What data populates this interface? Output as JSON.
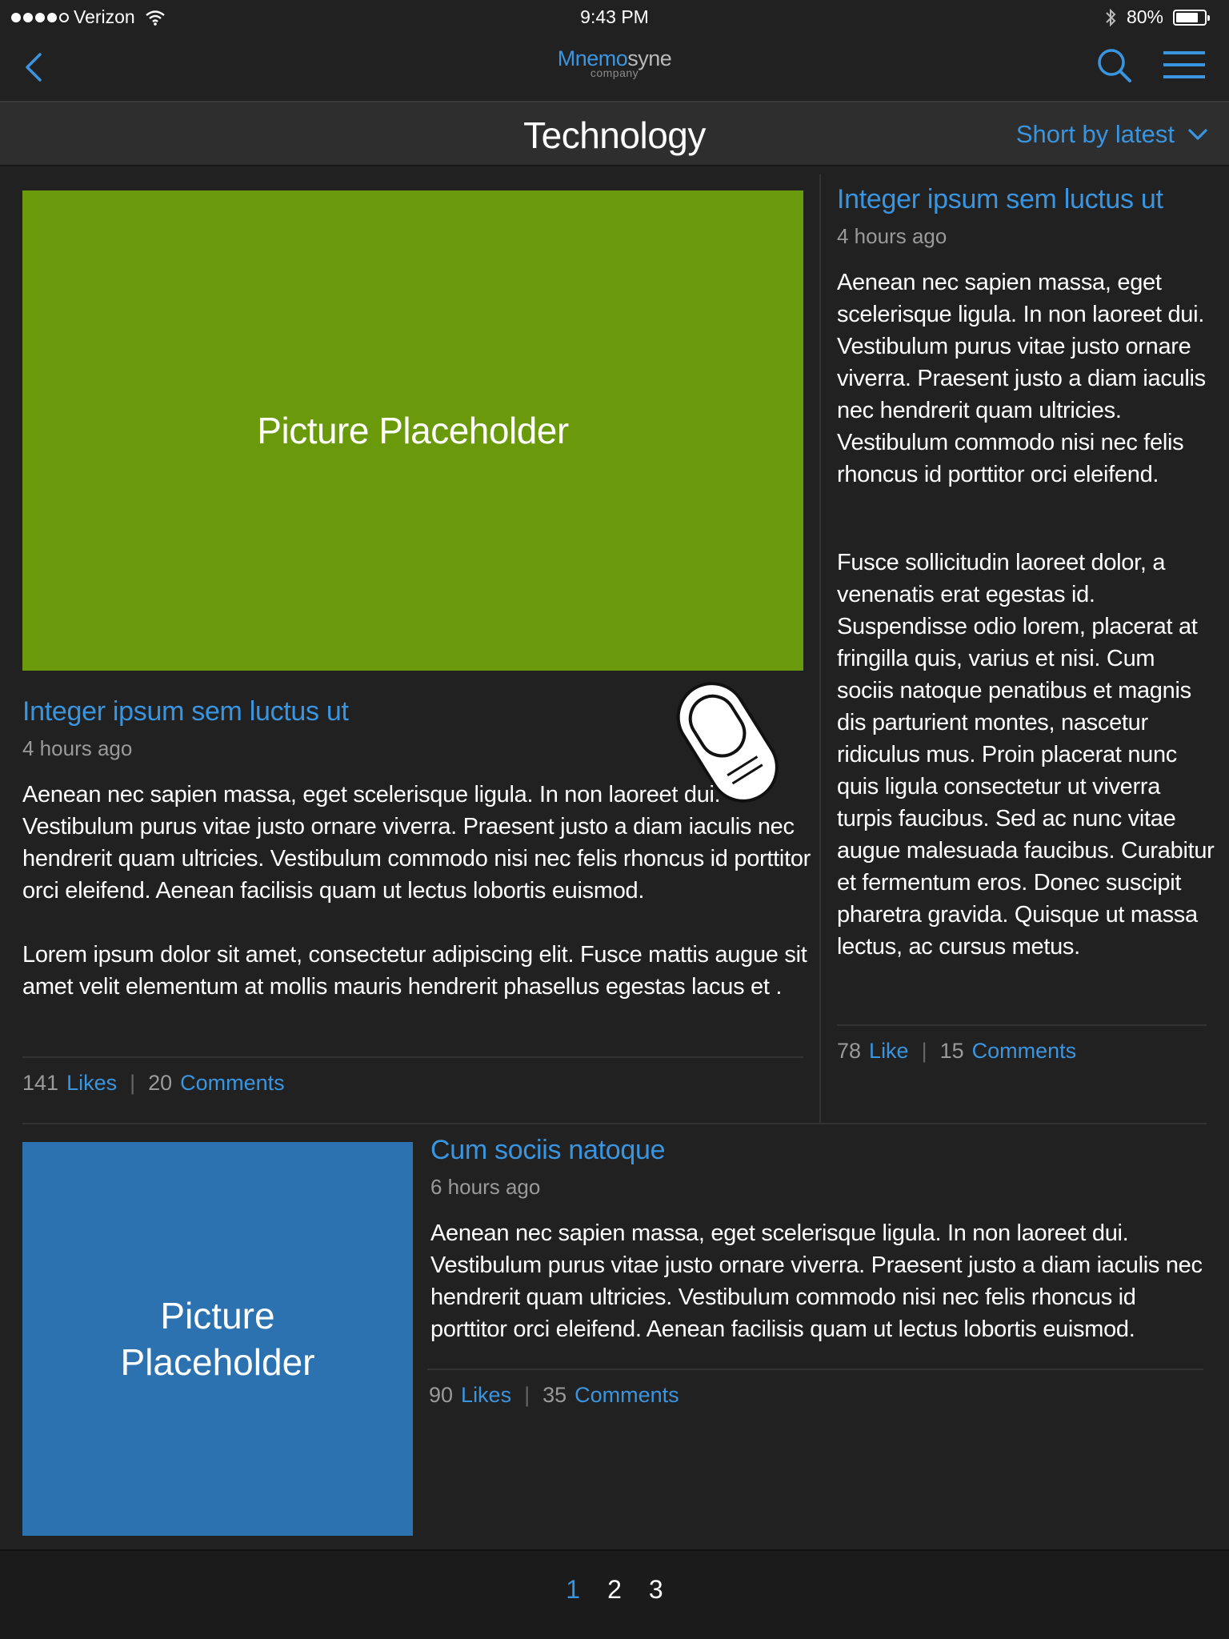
{
  "status_bar": {
    "carrier": "Verizon",
    "time": "9:43 PM",
    "battery_text": "80%",
    "battery_level": 0.8
  },
  "nav": {
    "logo_part1": "Mnemo",
    "logo_part2": "syne",
    "logo_sub": "company"
  },
  "category": {
    "title": "Technology",
    "sort_label": "Short by latest"
  },
  "articles": [
    {
      "image_label": "Picture Placeholder",
      "image_color": "#6a9a0b",
      "title": "Integer ipsum sem luctus ut",
      "time": "4 hours ago",
      "paragraph1": "Aenean nec sapien massa, eget scelerisque ligula. In non laoreet dui. Vestibulum purus vitae justo ornare viverra. Praesent justo a diam iaculis nec hendrerit quam ultricies. Vestibulum commodo nisi nec felis rhoncus id porttitor orci eleifend. Aenean facilisis quam ut lectus lobortis euismod.",
      "paragraph2": "Lorem ipsum dolor sit amet, consectetur adipiscing elit. Fusce mattis augue sit amet velit elementum at mollis mauris hendrerit phasellus egestas lacus et .",
      "likes_count": "141",
      "likes_label": "Likes",
      "comments_count": "20",
      "comments_label": "Comments"
    },
    {
      "title": "Integer ipsum sem luctus ut",
      "time": "4 hours ago",
      "paragraph1": "Aenean nec sapien massa, eget scelerisque ligula. In non laoreet dui. Vestibulum purus vitae justo ornare viverra. Praesent justo a diam iaculis nec hendrerit quam ultricies. Vestibulum commodo nisi nec felis rhoncus id porttitor orci eleifend.",
      "paragraph2": "Fusce sollicitudin laoreet dolor, a venenatis erat egestas id. Suspendisse odio lorem, placerat at fringilla quis, varius et nisi. Cum sociis natoque penatibus et magnis dis parturient montes, nascetur ridiculus mus. Proin placerat nunc quis ligula consectetur ut viverra turpis faucibus. Sed ac nunc vitae augue malesuada faucibus. Curabitur et fermentum eros. Donec suscipit pharetra gravida. Quisque ut massa lectus, ac cursus metus.",
      "likes_count": "78",
      "likes_label": "Like",
      "comments_count": "15",
      "comments_label": "Comments"
    },
    {
      "image_label_line1": "Picture",
      "image_label_line2": "Placeholder",
      "image_color": "#2d72b0",
      "title": "Cum sociis natoque",
      "time": "6 hours ago",
      "paragraph1": "Aenean nec sapien massa, eget scelerisque ligula. In non laoreet dui. Vestibulum purus vitae justo ornare viverra. Praesent justo a diam iaculis nec hendrerit quam ultricies. Vestibulum commodo nisi nec felis rhoncus id porttitor orci eleifend. Aenean facilisis quam ut lectus lobortis euismod.",
      "likes_count": "90",
      "likes_label": "Likes",
      "comments_count": "35",
      "comments_label": "Comments"
    }
  ],
  "pagination": {
    "pages": [
      "1",
      "2",
      "3"
    ],
    "current": "1"
  },
  "colors": {
    "accent": "#3a95e0",
    "background": "#212121"
  },
  "icons": [
    "back-chevron-icon",
    "search-icon",
    "menu-icon",
    "chevron-down-icon",
    "wifi-icon",
    "bluetooth-icon",
    "battery-icon",
    "tap-gesture-icon"
  ]
}
